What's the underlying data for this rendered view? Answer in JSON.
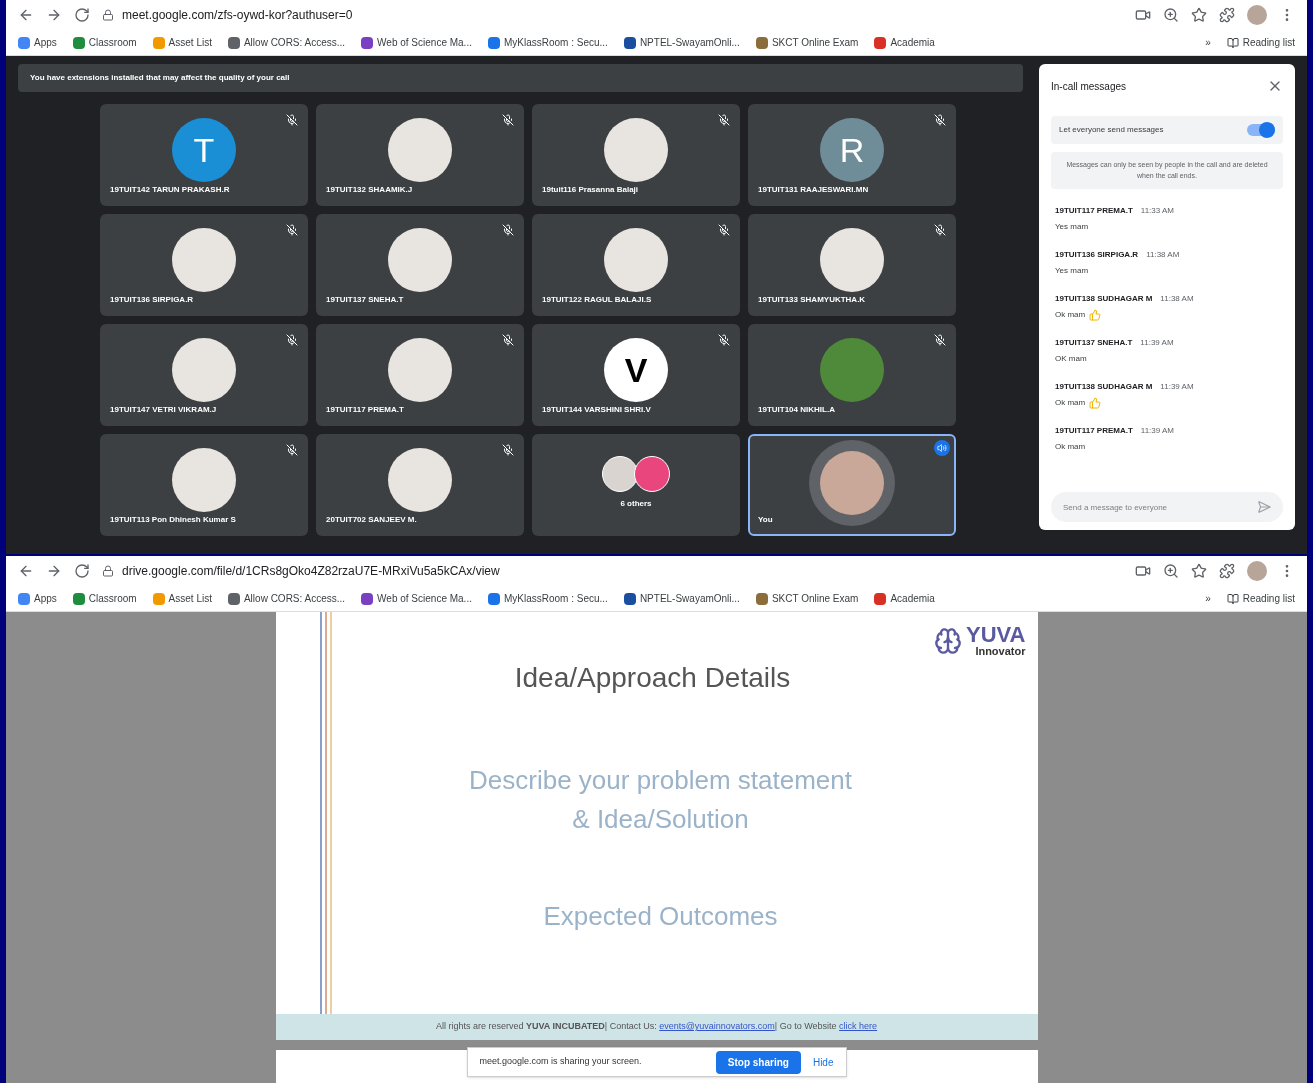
{
  "meet_window": {
    "address_bar": {
      "url": "meet.google.com/zfs-oywd-kor?authuser=0"
    },
    "bookmarks": [
      {
        "label": "Apps",
        "color": "#4285f4"
      },
      {
        "label": "Classroom",
        "color": "#1e8e3e"
      },
      {
        "label": "Asset List",
        "color": "#f29900"
      },
      {
        "label": "Allow CORS: Access...",
        "color": "#5f6368"
      },
      {
        "label": "Web of Science Ma...",
        "color": "#7b3fc4"
      },
      {
        "label": "MyKlassRoom : Secu...",
        "color": "#1a73e8"
      },
      {
        "label": "NPTEL-SwayamOnli...",
        "color": "#1a4fa0"
      },
      {
        "label": "SKCT Online Exam",
        "color": "#8a6d3b"
      },
      {
        "label": "Academia",
        "color": "#d93025"
      }
    ],
    "bookmarks_more": "»",
    "reading_list": "Reading list",
    "notice": "You have extensions installed that may affect the quality of your call",
    "tiles": [
      {
        "kind": "letter",
        "letter": "T",
        "color": "#1a8fd6",
        "name": "19TUIT142 TARUN PRAKASH.R",
        "muted": true
      },
      {
        "kind": "photo",
        "name": "19TUIT132 SHAAMIK.J",
        "muted": true
      },
      {
        "kind": "photo",
        "name": "19tuit116 Prasanna Balaji",
        "muted": true
      },
      {
        "kind": "letter",
        "letter": "R",
        "color": "#6f8d99",
        "name": "19TUIT131 RAAJESWARI.MN",
        "muted": true
      },
      {
        "kind": "photo",
        "name": "19TUIT136 SIRPIGA.R",
        "muted": true
      },
      {
        "kind": "photo",
        "name": "19TUIT137 SNEHA.T",
        "muted": true
      },
      {
        "kind": "photo",
        "name": "19TUIT122 RAGUL BALAJI.S",
        "muted": true
      },
      {
        "kind": "photo",
        "name": "19TUIT133 SHAMYUKTHA.K",
        "muted": true
      },
      {
        "kind": "photo",
        "name": "19TUIT147 VETRI VIKRAM.J",
        "muted": true
      },
      {
        "kind": "photo",
        "name": "19TUIT117 PREMA.T",
        "muted": true
      },
      {
        "kind": "letter",
        "letter": "V",
        "color": "#ffffff",
        "name": "19TUIT144 VARSHINI SHRI.V",
        "muted": true
      },
      {
        "kind": "scenery",
        "name": "19TUIT104 NIKHIL.A",
        "muted": true
      },
      {
        "kind": "photo",
        "name": "19TUIT113 Pon Dhinesh Kumar S",
        "muted": true
      },
      {
        "kind": "photo",
        "name": "20TUIT702 SANJEEV M.",
        "muted": true
      },
      {
        "kind": "others",
        "name": "6 others",
        "muted": false
      },
      {
        "kind": "self",
        "name": "You",
        "muted": false,
        "selected": true
      }
    ],
    "chat": {
      "title": "In-call messages",
      "toggle": {
        "label": "Let everyone send messages",
        "on": true
      },
      "info": "Messages can only be seen by people in the call and are deleted when the call ends.",
      "messages": [
        {
          "sender": "19TUIT117 PREMA.T",
          "time": "11:33 AM",
          "text": "Yes mam",
          "thumbs_up": false
        },
        {
          "sender": "19TUIT136 SIRPIGA.R",
          "time": "11:38 AM",
          "text": "Yes mam",
          "thumbs_up": false
        },
        {
          "sender": "19TUIT138 SUDHAGAR M",
          "time": "11:38 AM",
          "text": "Ok mam",
          "thumbs_up": true
        },
        {
          "sender": "19TUIT137 SNEHA.T",
          "time": "11:39 AM",
          "text": "OK mam",
          "thumbs_up": false
        },
        {
          "sender": "19TUIT138 SUDHAGAR M",
          "time": "11:39 AM",
          "text": "Ok mam",
          "thumbs_up": true
        },
        {
          "sender": "19TUIT117 PREMA.T",
          "time": "11:39 AM",
          "text": "Ok mam",
          "thumbs_up": false
        }
      ],
      "input": {
        "placeholder": "Send a message to everyone"
      }
    }
  },
  "drive_window": {
    "address_bar": {
      "url": "drive.google.com/file/d/1CRs8gOko4Z82rzaU7E-MRxiVu5a5kCAx/view"
    },
    "bookmarks": [
      {
        "label": "Apps",
        "color": "#4285f4"
      },
      {
        "label": "Classroom",
        "color": "#1e8e3e"
      },
      {
        "label": "Asset List",
        "color": "#f29900"
      },
      {
        "label": "Allow CORS: Access...",
        "color": "#5f6368"
      },
      {
        "label": "Web of Science Ma...",
        "color": "#7b3fc4"
      },
      {
        "label": "MyKlassRoom : Secu...",
        "color": "#1a73e8"
      },
      {
        "label": "NPTEL-SwayamOnli...",
        "color": "#1a4fa0"
      },
      {
        "label": "SKCT Online Exam",
        "color": "#8a6d3b"
      },
      {
        "label": "Academia",
        "color": "#d93025"
      }
    ],
    "bookmarks_more": "»",
    "reading_list": "Reading list",
    "slide": {
      "logo": {
        "word": "YUVA",
        "sub": "Innovator"
      },
      "title": "Idea/Approach Details",
      "points": [
        "Describe your problem statement\n& Idea/Solution",
        "Expected Outcomes"
      ],
      "footer": {
        "text": "All rights are reserved **YUVA INCUBATED**| Contact Us: ",
        "email": "events@yuvainnovators.com",
        "middle": "| Go to Website ",
        "link": "click here"
      }
    },
    "share_bar": {
      "message": "meet.google.com is sharing your screen.",
      "stop": "Stop sharing",
      "hide": "Hide"
    }
  }
}
